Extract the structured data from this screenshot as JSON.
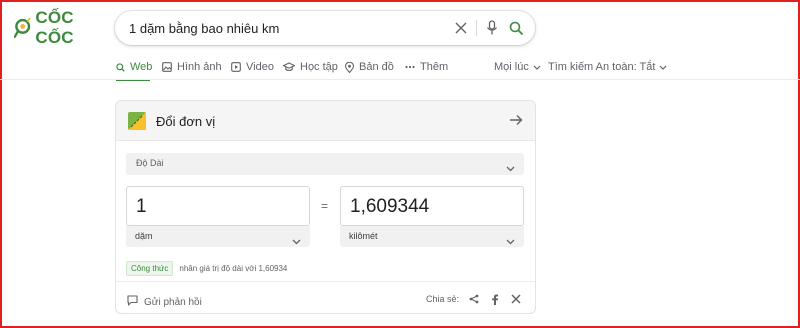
{
  "brand": {
    "name": "CỐC CỐC",
    "accent": "#3c8a3c"
  },
  "search": {
    "query": "1 dặm bằng bao nhiêu km",
    "placeholder": ""
  },
  "nav": {
    "tabs": [
      {
        "label": "Web",
        "icon": "search-icon",
        "active": true
      },
      {
        "label": "Hình ảnh",
        "icon": "image-icon"
      },
      {
        "label": "Video",
        "icon": "play-icon"
      },
      {
        "label": "Học tập",
        "icon": "graduation-cap-icon"
      },
      {
        "label": "Bản đồ",
        "icon": "map-pin-icon"
      },
      {
        "label": "Thêm",
        "icon": "more-dots-icon"
      }
    ],
    "time_filter": "Mọi lúc",
    "safe_search": "Tìm kiếm An toàn: Tắt"
  },
  "converter": {
    "title": "Đổi đơn vị",
    "category": "Độ Dài",
    "from": {
      "value": "1",
      "unit": "dặm"
    },
    "equals": "=",
    "to": {
      "value": "1,609344",
      "unit": "kilômét"
    },
    "formula_label": "Công thức",
    "formula_text": "nhân giá trị độ dài với 1,60934",
    "feedback": "Gửi phản hồi",
    "share_label": "Chia sẻ:",
    "share_icons": [
      "share-icon",
      "facebook-icon",
      "x-icon"
    ]
  }
}
